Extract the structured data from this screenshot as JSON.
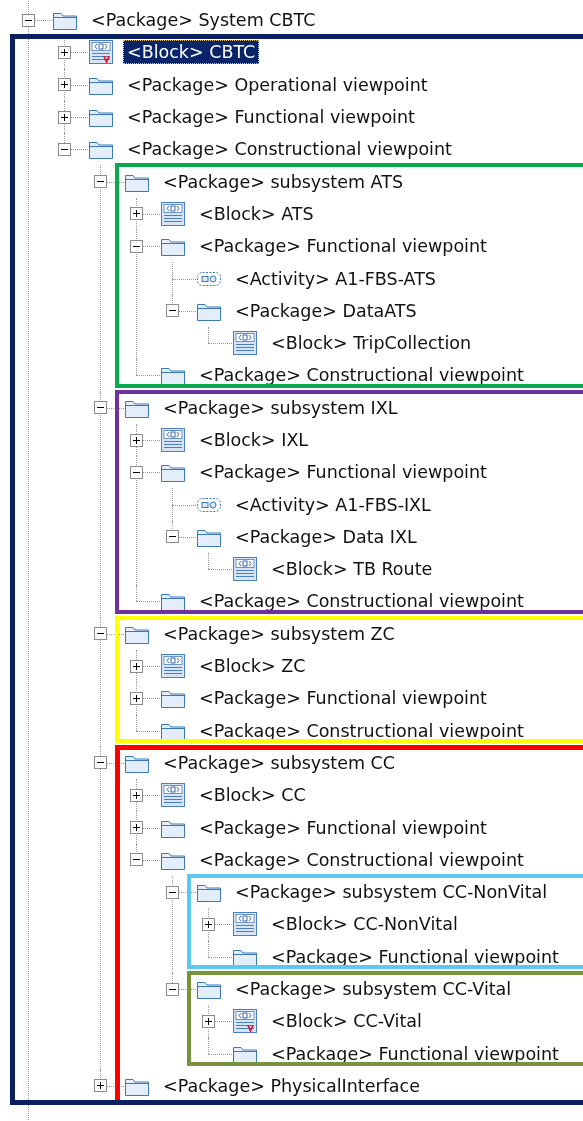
{
  "tree": [
    {
      "kind": "package",
      "label": "<Package> System CBTC",
      "expanded": true,
      "marked": false,
      "selected": false,
      "frame": {
        "color": "#0c1f5e",
        "kind": "children"
      },
      "children": [
        {
          "kind": "block",
          "label": "<Block> CBTC",
          "expanded": false,
          "marked": true,
          "selected": true
        },
        {
          "kind": "package",
          "label": "<Package> Operational viewpoint",
          "expanded": false,
          "marked": false,
          "selected": false
        },
        {
          "kind": "package",
          "label": "<Package> Functional viewpoint",
          "expanded": false,
          "marked": false,
          "selected": false
        },
        {
          "kind": "package",
          "label": "<Package> Constructional viewpoint",
          "expanded": true,
          "marked": false,
          "selected": false,
          "children": [
            {
              "kind": "package",
              "label": "<Package> subsystem ATS",
              "expanded": true,
              "marked": false,
              "selected": false,
              "frame": {
                "color": "#0aa84f",
                "kind": "subtree"
              },
              "children": [
                {
                  "kind": "block",
                  "label": "<Block> ATS",
                  "expanded": false,
                  "marked": false,
                  "selected": false
                },
                {
                  "kind": "package",
                  "label": "<Package> Functional viewpoint",
                  "expanded": true,
                  "marked": false,
                  "selected": false,
                  "children": [
                    {
                      "kind": "activity",
                      "label": "<Activity> A1-FBS-ATS",
                      "marked": false,
                      "selected": false
                    },
                    {
                      "kind": "package",
                      "label": "<Package> DataATS",
                      "expanded": true,
                      "marked": false,
                      "selected": false,
                      "children": [
                        {
                          "kind": "block",
                          "label": "<Block> TripCollection",
                          "marked": false,
                          "selected": false
                        }
                      ]
                    }
                  ]
                },
                {
                  "kind": "package",
                  "label": "<Package> Constructional viewpoint",
                  "marked": false,
                  "selected": false
                }
              ]
            },
            {
              "kind": "package",
              "label": "<Package> subsystem IXL",
              "expanded": true,
              "marked": false,
              "selected": false,
              "frame": {
                "color": "#7030a0",
                "kind": "subtree"
              },
              "children": [
                {
                  "kind": "block",
                  "label": "<Block> IXL",
                  "expanded": false,
                  "marked": false,
                  "selected": false
                },
                {
                  "kind": "package",
                  "label": "<Package> Functional viewpoint",
                  "expanded": true,
                  "marked": false,
                  "selected": false,
                  "children": [
                    {
                      "kind": "activity",
                      "label": "<Activity> A1-FBS-IXL",
                      "marked": false,
                      "selected": false
                    },
                    {
                      "kind": "package",
                      "label": "<Package> Data IXL",
                      "expanded": true,
                      "marked": false,
                      "selected": false,
                      "children": [
                        {
                          "kind": "block",
                          "label": "<Block> TB Route",
                          "marked": false,
                          "selected": false
                        }
                      ]
                    }
                  ]
                },
                {
                  "kind": "package",
                  "label": "<Package> Constructional viewpoint",
                  "marked": false,
                  "selected": false
                }
              ]
            },
            {
              "kind": "package",
              "label": "<Package> subsystem ZC",
              "expanded": true,
              "marked": false,
              "selected": false,
              "frame": {
                "color": "#ffff00",
                "kind": "subtree"
              },
              "children": [
                {
                  "kind": "block",
                  "label": "<Block> ZC",
                  "expanded": false,
                  "marked": false,
                  "selected": false
                },
                {
                  "kind": "package",
                  "label": "<Package> Functional viewpoint",
                  "expanded": false,
                  "marked": false,
                  "selected": false
                },
                {
                  "kind": "package",
                  "label": "<Package> Constructional viewpoint",
                  "marked": false,
                  "selected": false
                }
              ]
            },
            {
              "kind": "package",
              "label": "<Package> subsystem CC",
              "expanded": true,
              "marked": false,
              "selected": false,
              "frame": {
                "color": "#ff0000",
                "kind": "subtree_and_next"
              },
              "children": [
                {
                  "kind": "block",
                  "label": "<Block> CC",
                  "expanded": false,
                  "marked": false,
                  "selected": false
                },
                {
                  "kind": "package",
                  "label": "<Package> Functional viewpoint",
                  "expanded": false,
                  "marked": false,
                  "selected": false
                },
                {
                  "kind": "package",
                  "label": "<Package> Constructional viewpoint",
                  "expanded": true,
                  "marked": false,
                  "selected": false,
                  "children": [
                    {
                      "kind": "package",
                      "label": "<Package> subsystem CC-NonVital",
                      "expanded": true,
                      "marked": false,
                      "selected": false,
                      "frame": {
                        "color": "#5bc8f0",
                        "kind": "subtree"
                      },
                      "children": [
                        {
                          "kind": "block",
                          "label": "<Block> CC-NonVital",
                          "expanded": false,
                          "marked": false,
                          "selected": false
                        },
                        {
                          "kind": "package",
                          "label": "<Package> Functional viewpoint",
                          "marked": false,
                          "selected": false
                        }
                      ]
                    },
                    {
                      "kind": "package",
                      "label": "<Package> subsystem CC-Vital",
                      "expanded": true,
                      "marked": false,
                      "selected": false,
                      "frame": {
                        "color": "#77933c",
                        "kind": "subtree"
                      },
                      "children": [
                        {
                          "kind": "block",
                          "label": "<Block> CC-Vital",
                          "expanded": false,
                          "marked": true,
                          "selected": false
                        },
                        {
                          "kind": "package",
                          "label": "<Package> Functional viewpoint",
                          "marked": false,
                          "selected": false
                        }
                      ]
                    }
                  ]
                }
              ]
            },
            {
              "kind": "package",
              "label": "<Package> PhysicalInterface",
              "expanded": false,
              "marked": false,
              "selected": false
            }
          ]
        }
      ]
    }
  ]
}
